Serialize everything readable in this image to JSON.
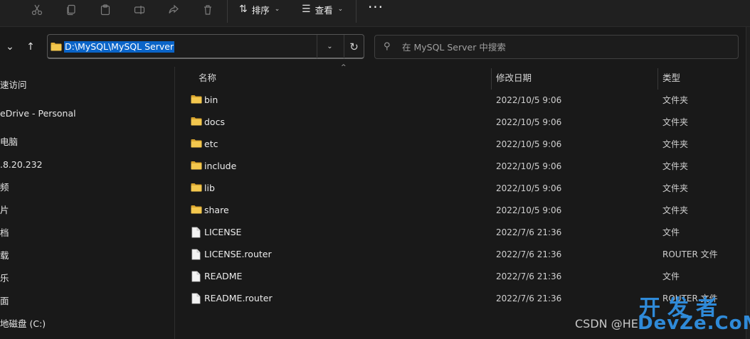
{
  "toolbar": {
    "icons": [
      "cut-icon",
      "copy-icon",
      "paste-icon",
      "rename-icon",
      "share-icon",
      "delete-icon"
    ],
    "sort_label": "排序",
    "view_label": "查看",
    "more_label": "···"
  },
  "address": {
    "path": "D:\\MySQL\\MySQL Server",
    "search_placeholder": "在 MySQL Server 中搜索"
  },
  "sidebar": {
    "items": [
      "速访问",
      "eDrive - Personal",
      "电脑",
      ".8.20.232",
      "频",
      "片",
      "档",
      "载",
      "乐",
      "面",
      "地磁盘 (C:)"
    ]
  },
  "columns": {
    "name": "名称",
    "modified": "修改日期",
    "type": "类型"
  },
  "files": [
    {
      "name": "bin",
      "modified": "2022/10/5 9:06",
      "type": "文件夹",
      "kind": "folder"
    },
    {
      "name": "docs",
      "modified": "2022/10/5 9:06",
      "type": "文件夹",
      "kind": "folder"
    },
    {
      "name": "etc",
      "modified": "2022/10/5 9:06",
      "type": "文件夹",
      "kind": "folder"
    },
    {
      "name": "include",
      "modified": "2022/10/5 9:06",
      "type": "文件夹",
      "kind": "folder"
    },
    {
      "name": "lib",
      "modified": "2022/10/5 9:06",
      "type": "文件夹",
      "kind": "folder"
    },
    {
      "name": "share",
      "modified": "2022/10/5 9:06",
      "type": "文件夹",
      "kind": "folder"
    },
    {
      "name": "LICENSE",
      "modified": "2022/7/6 21:36",
      "type": "文件",
      "kind": "file"
    },
    {
      "name": "LICENSE.router",
      "modified": "2022/7/6 21:36",
      "type": "ROUTER 文件",
      "kind": "file"
    },
    {
      "name": "README",
      "modified": "2022/7/6 21:36",
      "type": "文件",
      "kind": "file"
    },
    {
      "name": "README.router",
      "modified": "2022/7/6 21:36",
      "type": "ROUTER 文件",
      "kind": "file"
    }
  ],
  "colors": {
    "folder": "#e8b53a",
    "selection": "#0a64c8",
    "watermark": "#2f8ad8"
  },
  "watermark": {
    "csdn": "CSDN @HE",
    "logo_line1": "开发者",
    "logo_line2": "DevZe.CoM"
  }
}
